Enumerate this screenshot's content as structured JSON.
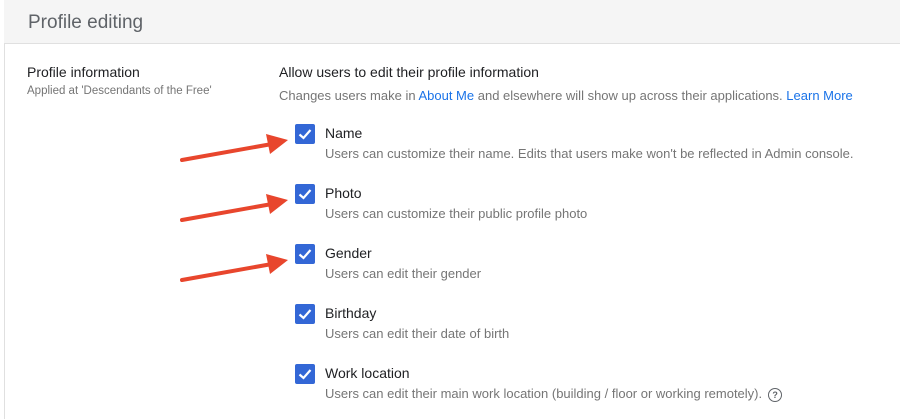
{
  "header": {
    "title": "Profile editing"
  },
  "section": {
    "title": "Profile information",
    "subtitle": "Applied at 'Descendants of the Free'"
  },
  "main": {
    "title": "Allow users to edit their profile information",
    "desc_prefix": "Changes users make in ",
    "about_me_link": "About Me",
    "desc_middle": " and elsewhere will show up across their applications. ",
    "learn_more_link": "Learn More"
  },
  "options": [
    {
      "label": "Name",
      "desc": "Users can customize their name. Edits that users make won't be reflected in Admin console.",
      "checked": true
    },
    {
      "label": "Photo",
      "desc": "Users can customize their public profile photo",
      "checked": true
    },
    {
      "label": "Gender",
      "desc": "Users can edit their gender",
      "checked": true
    },
    {
      "label": "Birthday",
      "desc": "Users can edit their date of birth",
      "checked": true
    },
    {
      "label": "Work location",
      "desc": "Users can edit their main work location (building / floor or working remotely).",
      "checked": true
    }
  ],
  "icons": {
    "check": "check-icon",
    "help": "help-circle-icon",
    "arrow": "red-arrow-annotation"
  },
  "colors": {
    "accent": "#3367d6",
    "link": "#1a73e8",
    "annotation": "#e8462d"
  }
}
